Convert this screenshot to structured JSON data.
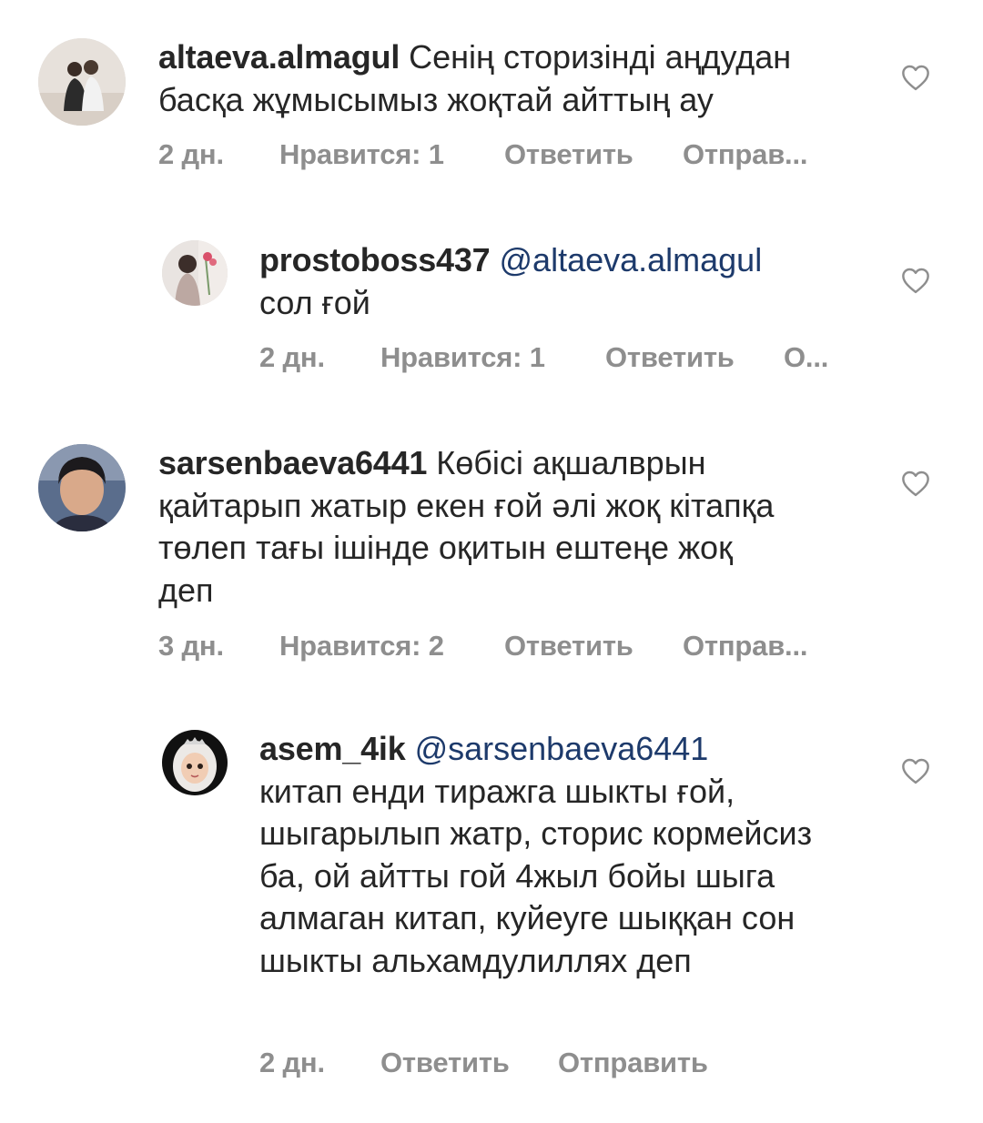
{
  "comments": [
    {
      "username": "altaeva.almagul",
      "mention": "",
      "text": "Сенің сторизінді аңдудан басқа жұмысымыз жоқтай айттың ау",
      "time": "2 дн.",
      "likes": "Нравится: 1",
      "reply": "Ответить",
      "send": "Отправ..."
    },
    {
      "username": "prostoboss437",
      "mention": "@altaeva.almagul",
      "text": "сол ғой",
      "time": "2 дн.",
      "likes": "Нравится: 1",
      "reply": "Ответить",
      "send": "О..."
    },
    {
      "username": "sarsenbaeva6441",
      "mention": "",
      "text": "Көбісі ақшалврын қайтарып жатыр екен ғой әлі жоқ кітапқа төлеп тағы ішінде оқитын ештеңе жоқ деп",
      "time": "3 дн.",
      "likes": "Нравится: 2",
      "reply": "Ответить",
      "send": "Отправ..."
    },
    {
      "username": "asem_4ik",
      "mention": "@sarsenbaeva6441",
      "text": "китап енди тиражга шыкты ғой, шыгарылып жатр, сторис кормейсиз ба, ой айтты гой 4жыл бойы шыга алмаган китап, куйеуге шыққан сон шыкты альхамдулиллях деп",
      "time": "2 дн.",
      "reply": "Ответить",
      "send": "Отправить"
    }
  ],
  "icons": {
    "like": "heart-outline-icon",
    "avatar": "user-avatar"
  },
  "colors": {
    "text": "#262626",
    "meta": "#8e8e8e",
    "mention": "#1d3a6b"
  }
}
